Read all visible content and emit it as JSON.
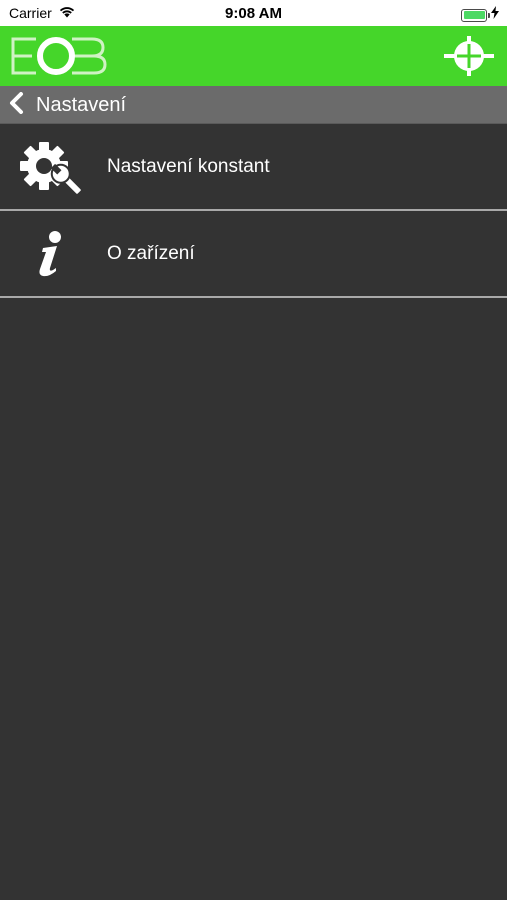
{
  "status_bar": {
    "carrier": "Carrier",
    "time": "9:08 AM",
    "battery_level": 1.0,
    "battery_color": "#4cd964"
  },
  "header": {
    "logo_text": "EOB",
    "background_color": "#45d62a",
    "right_icon": "crosshair-icon"
  },
  "nav": {
    "back_icon": "chevron-left-icon",
    "title": "Nastavení",
    "background_color": "#6b6b6b"
  },
  "menu": {
    "items": [
      {
        "icon": "gear-wrench-icon",
        "label": "Nastavení konstant"
      },
      {
        "icon": "info-icon",
        "label": "O zařízení"
      }
    ]
  }
}
